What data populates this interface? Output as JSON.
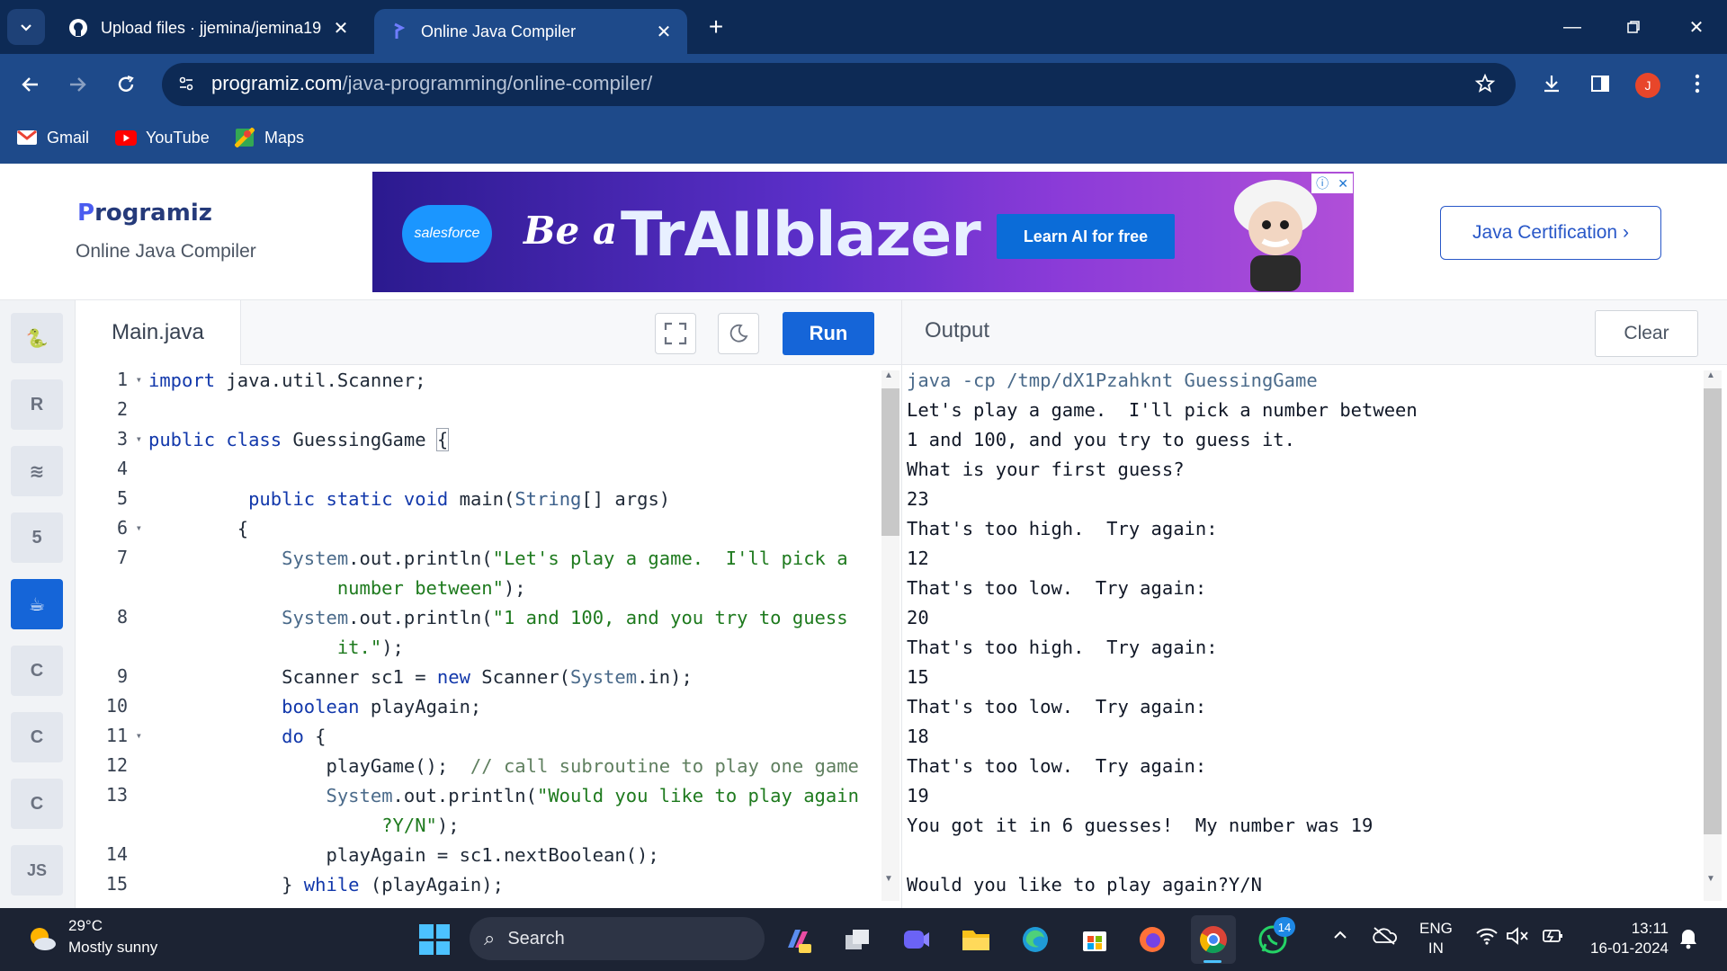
{
  "browser": {
    "tabs": [
      {
        "title": "Upload files · jjemina/jemina19",
        "active": false,
        "icon": "github-icon"
      },
      {
        "title": "Online Java Compiler",
        "active": true,
        "icon": "programiz-icon"
      }
    ],
    "url_domain": "programiz.com",
    "url_path": "/java-programming/online-compiler/",
    "profile_initial": "J",
    "bookmarks": [
      {
        "label": "Gmail",
        "icon": "gmail-icon"
      },
      {
        "label": "YouTube",
        "icon": "youtube-icon"
      },
      {
        "label": "Maps",
        "icon": "maps-icon"
      }
    ]
  },
  "header": {
    "logo_first": "P",
    "logo_rest": "rogramiz",
    "subtitle": "Online Java Compiler",
    "certification_button": "Java Certification ›"
  },
  "ad": {
    "brand": "salesforce",
    "tagline": "Be a",
    "headline": "TrAIlblazer",
    "cta": "Learn AI for free"
  },
  "sidebar": {
    "languages": [
      {
        "name": "python",
        "glyph": "🐍",
        "active": false
      },
      {
        "name": "r",
        "glyph": "R",
        "active": false
      },
      {
        "name": "sql",
        "glyph": "≋",
        "active": false
      },
      {
        "name": "html",
        "glyph": "5",
        "active": false
      },
      {
        "name": "java",
        "glyph": "☕",
        "active": true
      },
      {
        "name": "c",
        "glyph": "C",
        "active": false
      },
      {
        "name": "cpp",
        "glyph": "C",
        "active": false
      },
      {
        "name": "csharp",
        "glyph": "C",
        "active": false
      },
      {
        "name": "js",
        "glyph": "JS",
        "active": false
      }
    ]
  },
  "editor": {
    "filename": "Main.java",
    "run_label": "Run",
    "line_numbers": [
      "1",
      "2",
      "3",
      "4",
      "5",
      "6",
      "7",
      "",
      "8",
      "",
      "9",
      "10",
      "11",
      "12",
      "13",
      "",
      "14",
      "15"
    ],
    "fold_lines": [
      "1",
      "3",
      "6",
      "11"
    ]
  },
  "output": {
    "title": "Output",
    "clear_label": "Clear",
    "lines": [
      "java -cp /tmp/dX1Pzahknt GuessingGame",
      "Let's play a game.  I'll pick a number between",
      "1 and 100, and you try to guess it.",
      "What is your first guess?",
      "23",
      "That's too high.  Try again:",
      "12",
      "That's too low.  Try again:",
      "20",
      "That's too high.  Try again:",
      "15",
      "That's too low.  Try again:",
      "18",
      "That's too low.  Try again:",
      "19",
      "You got it in 6 guesses!  My number was 19",
      "",
      "Would you like to play again?Y/N"
    ]
  },
  "taskbar": {
    "temperature": "29°C",
    "weather": "Mostly sunny",
    "search_placeholder": "Search",
    "whatsapp_badge": "14",
    "language_line1": "ENG",
    "language_line2": "IN",
    "time": "13:11",
    "date": "16-01-2024"
  }
}
